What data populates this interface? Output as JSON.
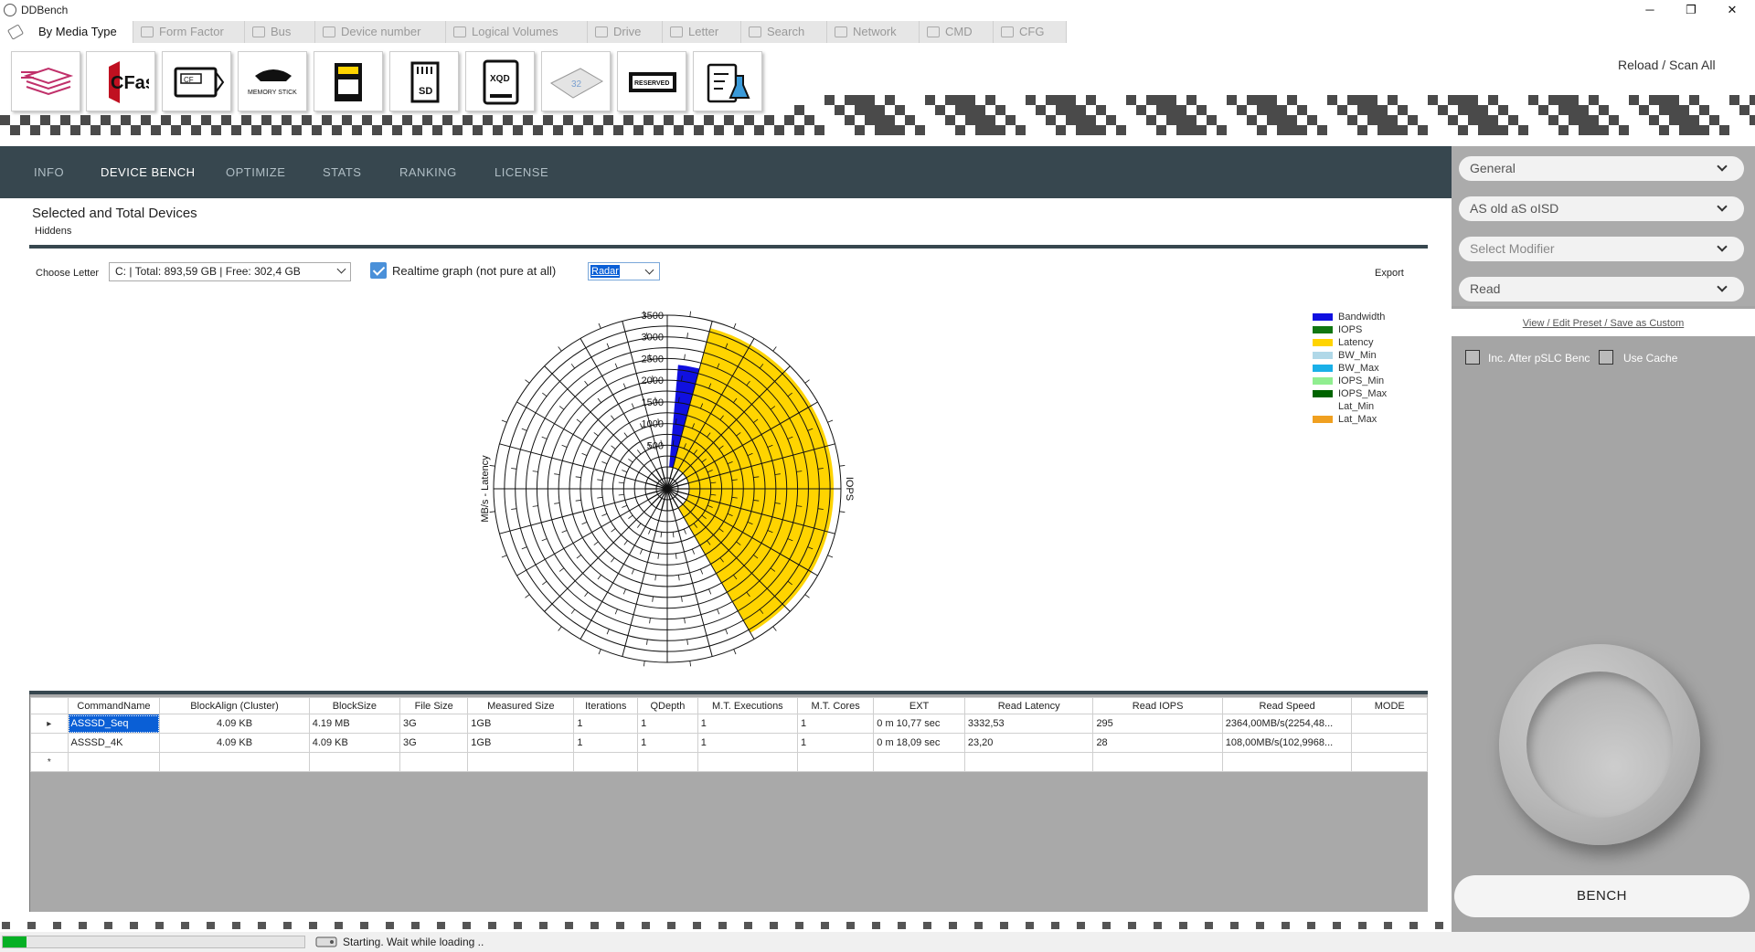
{
  "window": {
    "title": "DDBench",
    "controls": {
      "minimize": "─",
      "restore": "❐",
      "close": "✕"
    }
  },
  "category_tabs": [
    {
      "label": "By Media Type",
      "active": true
    },
    {
      "label": "Form Factor",
      "active": false
    },
    {
      "label": "Bus",
      "active": false
    },
    {
      "label": "Device number",
      "active": false
    },
    {
      "label": "Logical Volumes",
      "active": false
    },
    {
      "label": "Drive",
      "active": false
    },
    {
      "label": "Letter",
      "active": false
    },
    {
      "label": "Search",
      "active": false
    },
    {
      "label": "Network",
      "active": false
    },
    {
      "label": "CMD",
      "active": false
    },
    {
      "label": "CFG",
      "active": false
    }
  ],
  "media_buttons": [
    {
      "icon": "stacked-layers-icon"
    },
    {
      "icon": "cfast-card-icon",
      "text": "CFast"
    },
    {
      "icon": "cf-card-icon",
      "text": "CF"
    },
    {
      "icon": "memory-stick-icon",
      "text": "MEMORY STICK"
    },
    {
      "icon": "sd-card-black-icon"
    },
    {
      "icon": "sd-card-icon",
      "text": "SD"
    },
    {
      "icon": "xqd-card-icon",
      "text": "XQD"
    },
    {
      "icon": "usb-stick-icon",
      "text": "32"
    },
    {
      "icon": "reserved-icon",
      "text": "RESERVED"
    },
    {
      "icon": "lab-clipboard-icon"
    }
  ],
  "reload_label": "Reload / Scan All",
  "nav": [
    {
      "label": "INFO",
      "active": false
    },
    {
      "label": "DEVICE BENCH",
      "active": true
    },
    {
      "label": "OPTIMIZE",
      "active": false
    },
    {
      "label": "STATS",
      "active": false
    },
    {
      "label": "RANKING",
      "active": false
    },
    {
      "label": "LICENSE",
      "active": false
    }
  ],
  "content": {
    "title": "Selected and Total Devices",
    "subtitle": "Hiddens",
    "choose_letter_label": "Choose Letter",
    "letter_value": "C: | Total: 893,59 GB | Free: 302,4 GB",
    "realtime_label": "Realtime graph (not pure at all)",
    "realtime_checked": true,
    "graph_type": "Radar",
    "export_label": "Export"
  },
  "chart_data": {
    "type": "radar",
    "radial_ticks": [
      500,
      1000,
      1500,
      2000,
      2500,
      3000,
      3500
    ],
    "rmax": 3500,
    "left_axis_label": "MB/s - Latency",
    "right_axis_label": "IOPS",
    "series": [
      {
        "name": "Bandwidth",
        "color": "#1010e0",
        "sectors": [
          {
            "from": 5,
            "to": 15,
            "value": 2364
          }
        ]
      },
      {
        "name": "IOPS",
        "color": "#117711",
        "sectors": []
      },
      {
        "name": "Latency",
        "color": "#ffd400",
        "sectors": [
          {
            "from": 15,
            "to": 30,
            "value": 3332.53
          },
          {
            "from": 30,
            "to": 150,
            "value": 3332.53
          }
        ]
      },
      {
        "name": "BW_Min",
        "color": "#b0d8e8",
        "sectors": []
      },
      {
        "name": "BW_Max",
        "color": "#1ab0e8",
        "sectors": []
      },
      {
        "name": "IOPS_Min",
        "color": "#90ee90",
        "sectors": []
      },
      {
        "name": "IOPS_Max",
        "color": "#006400",
        "sectors": []
      },
      {
        "name": "Lat_Min",
        "color": "#ffffff",
        "sectors": []
      },
      {
        "name": "Lat_Max",
        "color": "#f0a020",
        "sectors": []
      }
    ]
  },
  "grid": {
    "columns": [
      "CommandName",
      "BlockAlign (Cluster)",
      "BlockSize",
      "File Size",
      "Measured Size",
      "Iterations",
      "QDepth",
      "M.T. Executions",
      "M.T. Cores",
      "EXT",
      "Read Latency",
      "Read IOPS",
      "Read Speed",
      "MODE"
    ],
    "rows": [
      [
        "ASSSD_Seq",
        "4.09 KB",
        "4.19 MB",
        "3G",
        "1GB",
        "1",
        "1",
        "1",
        "1",
        "0 m 10,77 sec",
        "3332,53",
        "295",
        "2364,00MB/s(2254,48...",
        ""
      ],
      [
        "ASSSD_4K",
        "4.09 KB",
        "4.09 KB",
        "3G",
        "1GB",
        "1",
        "1",
        "1",
        "1",
        "0 m 18,09 sec",
        "23,20",
        "28",
        "108,00MB/s(102,9968...",
        ""
      ]
    ],
    "row_markers": [
      "▸",
      "",
      "*"
    ]
  },
  "right_panel": {
    "dropdowns": [
      {
        "value": "General",
        "placeholder": false
      },
      {
        "value": "AS old aS oISD",
        "placeholder": false
      },
      {
        "value": "Select Modifier",
        "placeholder": true
      },
      {
        "value": "Read",
        "placeholder": false
      }
    ],
    "preset_link": "View / Edit Preset / Save as Custom",
    "inc_pslc_label": "Inc. After pSLC Bench",
    "use_cache_label": "Use Cache",
    "bench_label": "BENCH"
  },
  "status": {
    "text": "Starting. Wait while loading ..",
    "progress": 0.08
  }
}
